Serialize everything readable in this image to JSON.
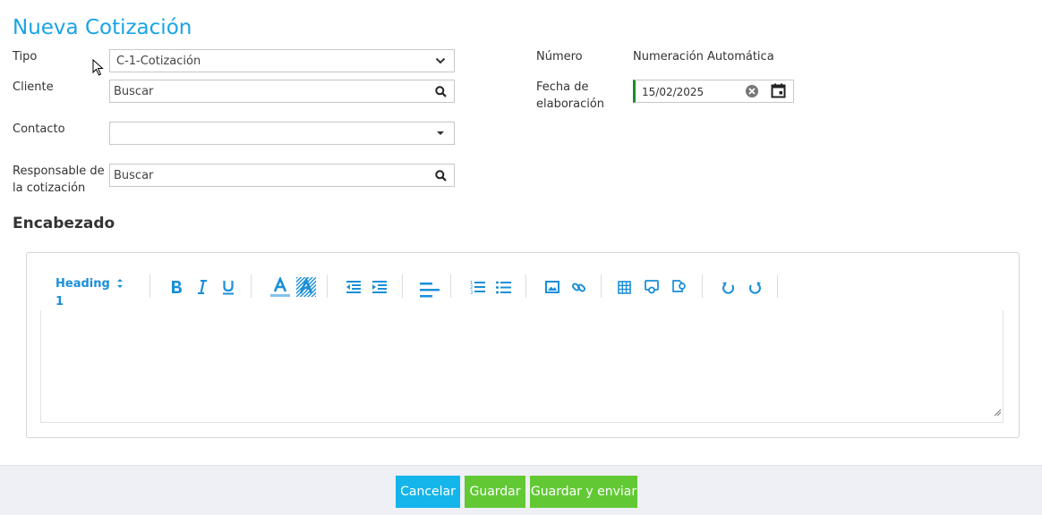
{
  "page": {
    "title": "Nueva Cotización"
  },
  "form": {
    "tipo": {
      "label": "Tipo",
      "value": "C-1-Cotización"
    },
    "cliente": {
      "label": "Cliente",
      "placeholder": "Buscar"
    },
    "contacto": {
      "label": "Contacto",
      "value": ""
    },
    "responsable": {
      "label_line1": "Responsable de",
      "label_line2": "la cotización",
      "placeholder": "Buscar"
    },
    "numero": {
      "label": "Número",
      "value": "Numeración Automática"
    },
    "fecha": {
      "label_line1": "Fecha de",
      "label_line2": "elaboración",
      "value": "15/02/2025"
    }
  },
  "editor": {
    "section_title": "Encabezado",
    "heading_line1": "Heading",
    "heading_line2": "1",
    "tools": [
      "bold-icon",
      "italic-icon",
      "underline-icon",
      "font-color-icon",
      "highlight-color-icon",
      "outdent-icon",
      "indent-icon",
      "align-left-icon",
      "ordered-list-icon",
      "unordered-list-icon",
      "image-icon",
      "link-icon",
      "table-icon",
      "media-icon",
      "file-icon",
      "undo-icon",
      "redo-icon"
    ],
    "accent_color": "#1a8fd8"
  },
  "footer": {
    "cancel_label": "Cancelar",
    "save_label": "Guardar",
    "save_send_label": "Guardar y enviar"
  },
  "colors": {
    "title": "#1aa3e6",
    "cancel": "#13b5ea",
    "save": "#62c935",
    "date_accent": "#1c8a2a"
  }
}
